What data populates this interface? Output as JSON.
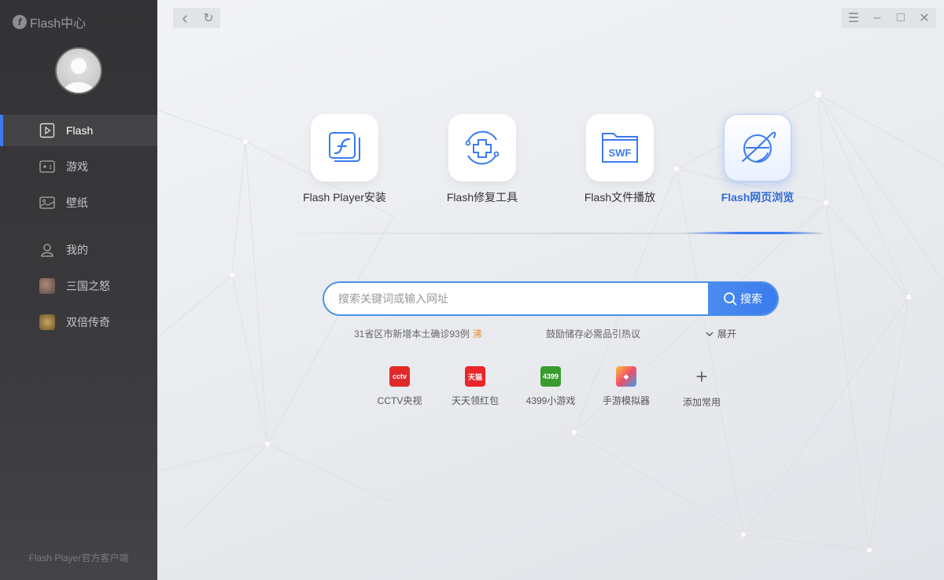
{
  "app": {
    "logo_text": "Flash中心",
    "footer": "Flash Player官方客户端"
  },
  "sidebar": {
    "items": [
      {
        "label": "Flash",
        "icon": "play-icon"
      },
      {
        "label": "游戏",
        "icon": "gamepad-icon"
      },
      {
        "label": "壁纸",
        "icon": "wallpaper-icon"
      },
      {
        "label": "我的",
        "icon": "user-icon"
      },
      {
        "label": "三国之怒",
        "icon": "game-thumb-icon"
      },
      {
        "label": "双倍传奇",
        "icon": "game-thumb-icon"
      }
    ],
    "active": "Flash"
  },
  "toolbar": {
    "back": "‹",
    "refresh": "↻"
  },
  "window": {
    "menu": "☰",
    "minimize": "–",
    "maximize": "□",
    "close": "✕"
  },
  "tools": [
    {
      "label": "Flash Player安装",
      "icon": "flash-install-icon"
    },
    {
      "label": "Flash修复工具",
      "icon": "repair-icon"
    },
    {
      "label": "Flash文件播放",
      "icon": "swf-file-icon"
    },
    {
      "label": "Flash网页浏览",
      "icon": "browser-icon",
      "active": true
    }
  ],
  "search": {
    "placeholder": "搜索关键词或输入网址",
    "button": "搜索"
  },
  "hot": {
    "items": [
      {
        "text": "31省区市新增本土确诊93例",
        "badge": "沸"
      },
      {
        "text": "鼓励储存必需品引热议"
      }
    ],
    "expand": "展开"
  },
  "sites": [
    {
      "label": "CCTV央视",
      "icon": "cctv-icon",
      "color": "#e02a2a",
      "mark": "cctv"
    },
    {
      "label": "天天领红包",
      "icon": "redpacket-icon",
      "color": "#e8262b",
      "mark": "天猫"
    },
    {
      "label": "4399小游戏",
      "icon": "4399-icon",
      "color": "#3a9b2f",
      "mark": "4399"
    },
    {
      "label": "手游模拟器",
      "icon": "emulator-icon",
      "color": "#f06b3b",
      "mark": "◆"
    },
    {
      "label": "添加常用",
      "icon": "plus-icon",
      "color": "#666666",
      "mark": "+"
    }
  ],
  "colors": {
    "accent": "#3a7bef",
    "sidebar_bg": "#333335"
  }
}
